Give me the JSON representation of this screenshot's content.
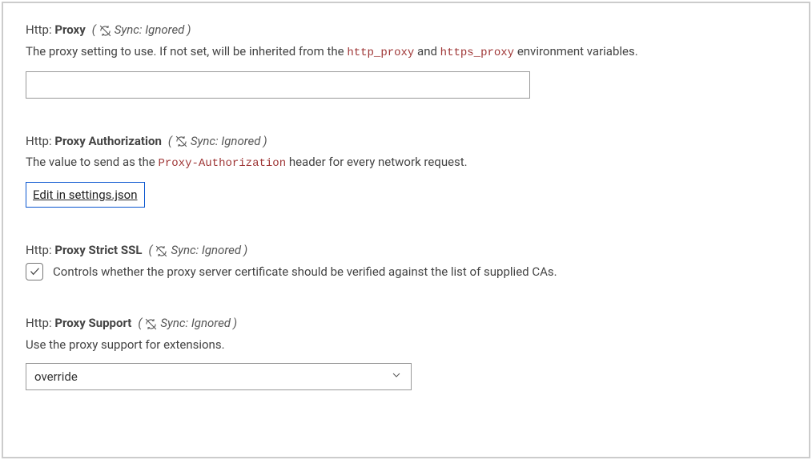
{
  "syncBadge": {
    "text": "Sync: Ignored"
  },
  "settings": {
    "proxy": {
      "category": "Http:",
      "name": "Proxy",
      "desc_pre": "The proxy setting to use. If not set, will be inherited from the ",
      "desc_code1": "http_proxy",
      "desc_mid": " and ",
      "desc_code2": "https_proxy",
      "desc_post": " environment variables.",
      "value": ""
    },
    "proxyAuth": {
      "category": "Http:",
      "name": "Proxy Authorization",
      "desc_pre": "The value to send as the ",
      "desc_code1": "Proxy-Authorization",
      "desc_post": " header for every network request.",
      "editLink": "Edit in settings.json"
    },
    "proxyStrictSSL": {
      "category": "Http:",
      "name": "Proxy Strict SSL",
      "desc": "Controls whether the proxy server certificate should be verified against the list of supplied CAs.",
      "checked": true
    },
    "proxySupport": {
      "category": "Http:",
      "name": "Proxy Support",
      "desc": "Use the proxy support for extensions.",
      "value": "override"
    }
  }
}
